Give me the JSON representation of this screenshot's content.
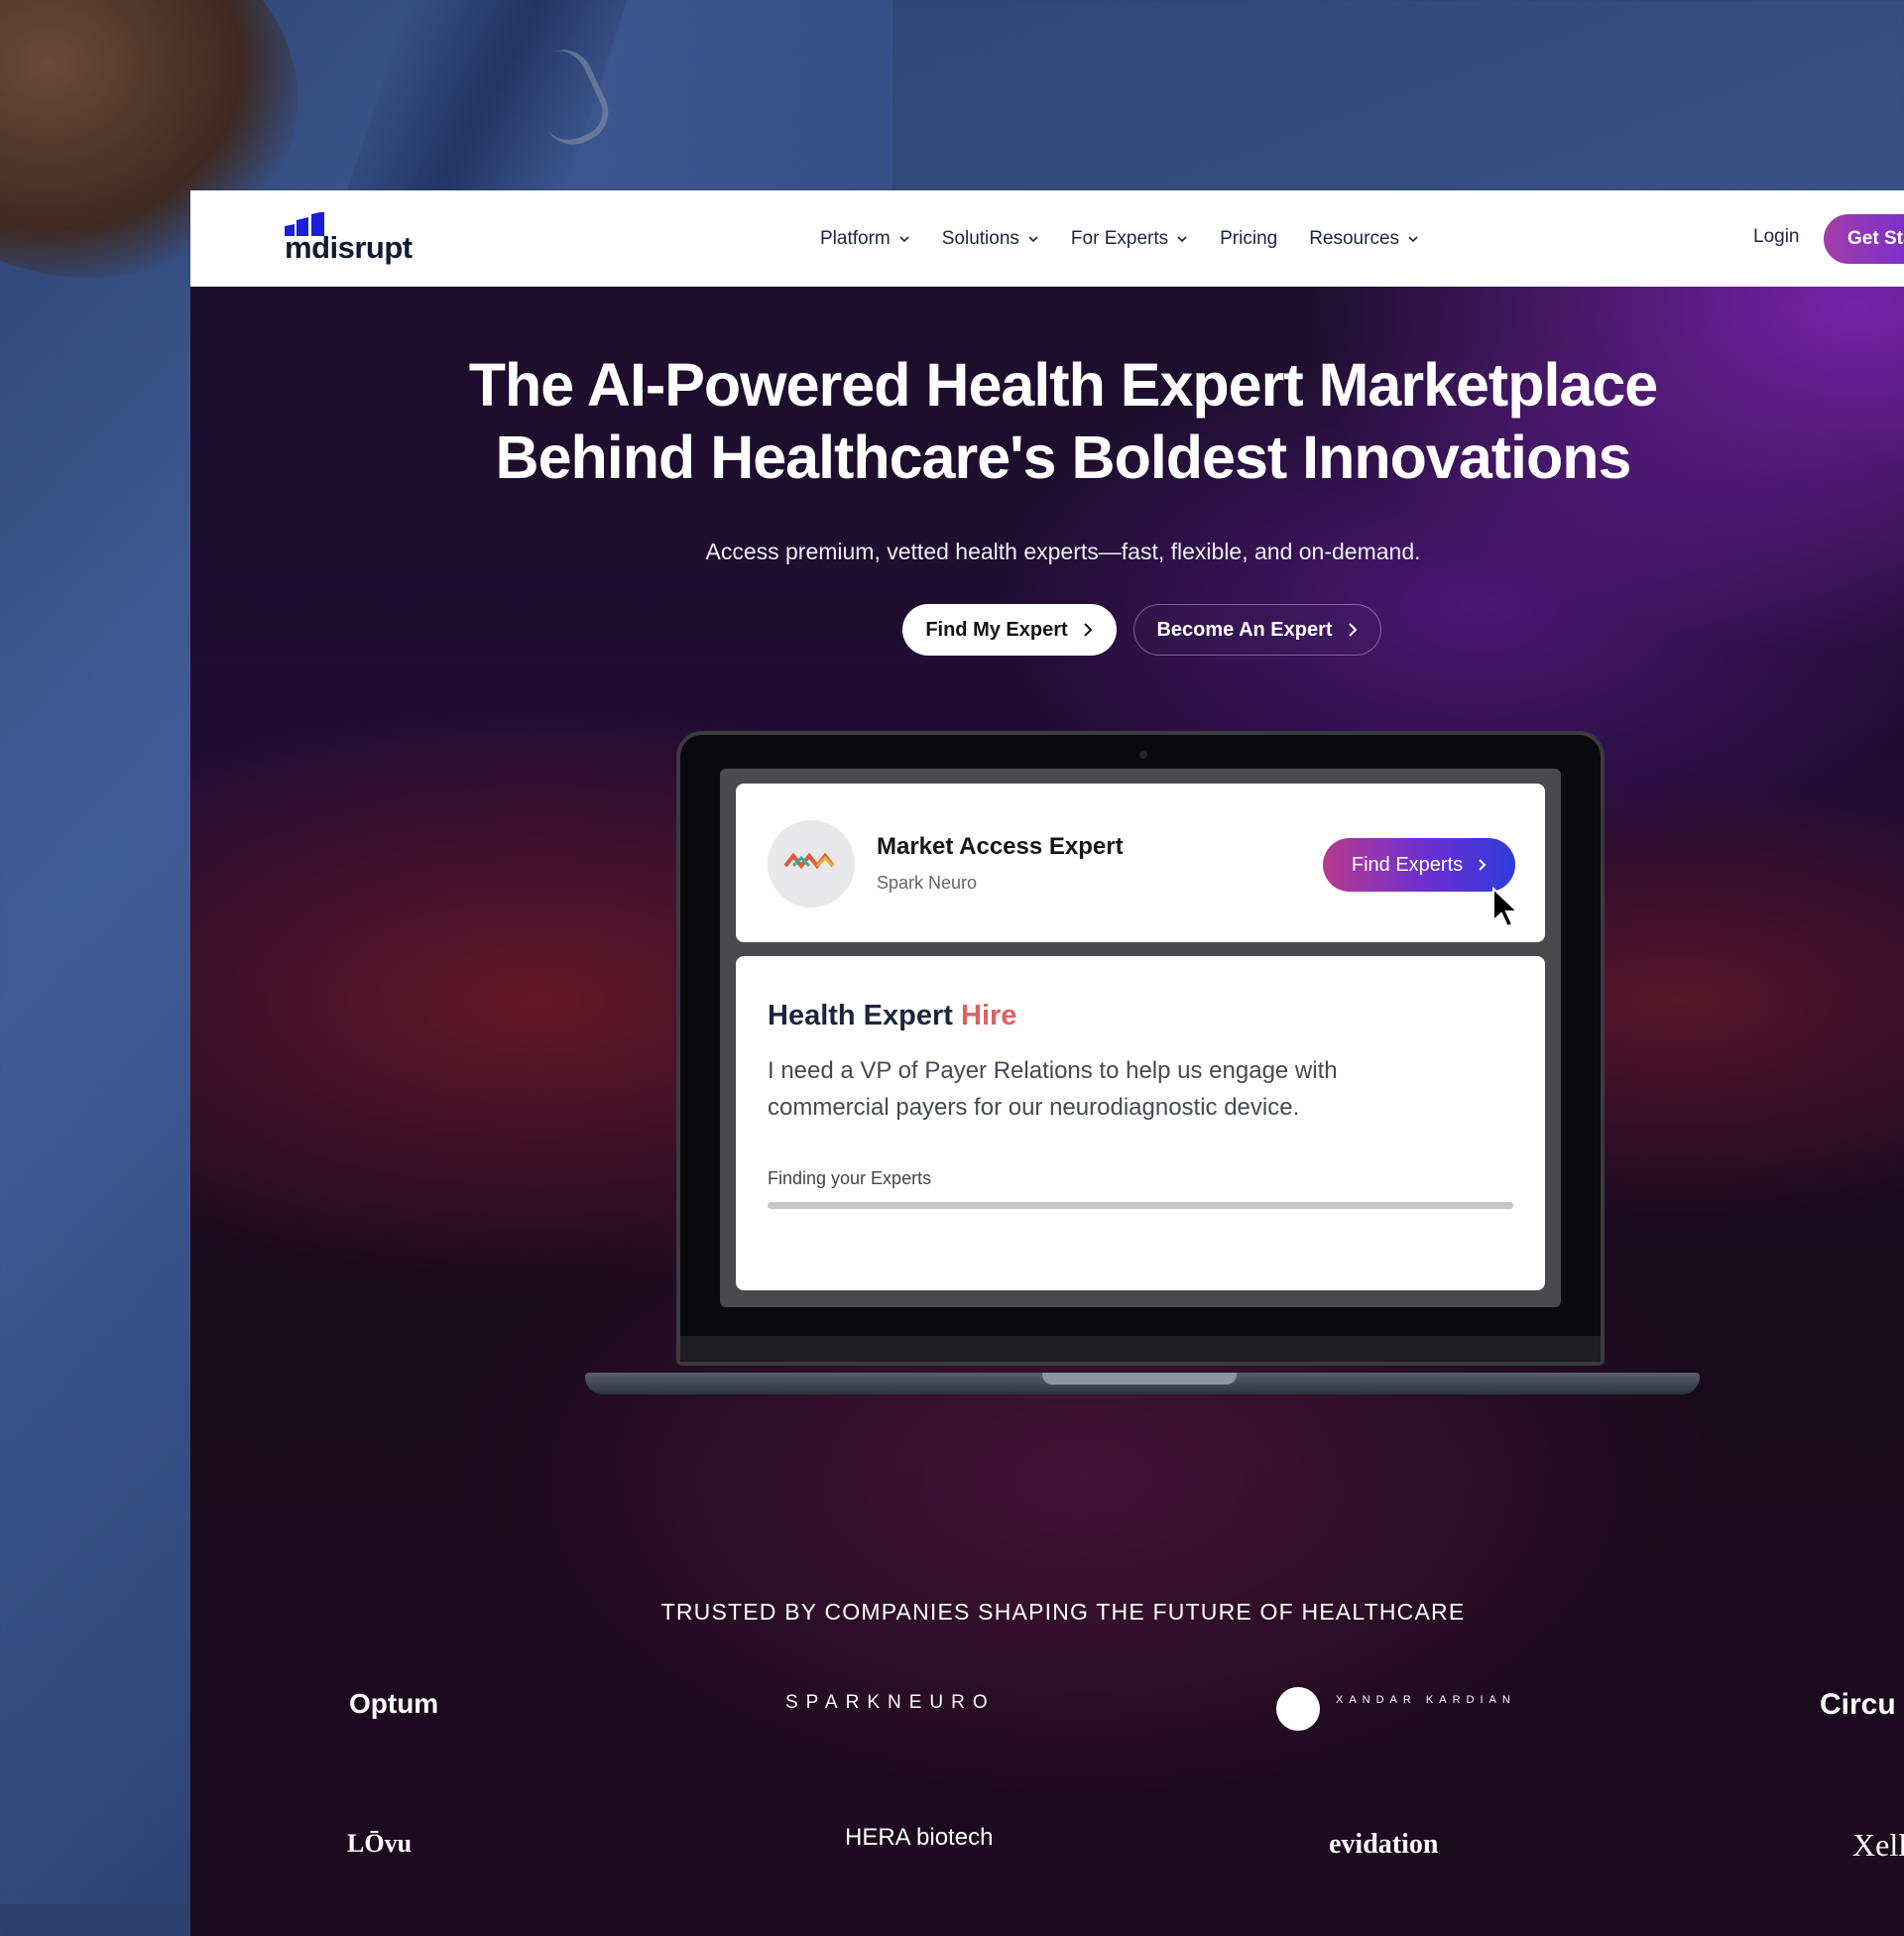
{
  "nav": {
    "logo_text": "mdisrupt",
    "menu": [
      {
        "label": "Platform",
        "has_dropdown": true
      },
      {
        "label": "Solutions",
        "has_dropdown": true
      },
      {
        "label": "For Experts",
        "has_dropdown": true
      },
      {
        "label": "Pricing",
        "has_dropdown": false
      },
      {
        "label": "Resources",
        "has_dropdown": true
      }
    ],
    "login_label": "Login",
    "cta_label": "Get Started"
  },
  "hero": {
    "title_line1": "The AI-Powered Health Expert Marketplace",
    "title_line2": "Behind Healthcare's Boldest Innovations",
    "subtitle": "Access premium, vetted health experts—fast, flexible, and on-demand.",
    "primary_button": "Find My Expert",
    "secondary_button": "Become An Expert"
  },
  "laptop_card": {
    "title": "Market Access Expert",
    "company": "Spark Neuro",
    "avatar_text": "SPARKNEURO",
    "button_label": "Find Experts"
  },
  "hire_card": {
    "title_main": "Health Expert",
    "title_accent": "Hire",
    "description": "I need a VP of Payer Relations to help us engage with commercial payers for our neurodiagnostic device.",
    "status_label": "Finding your Experts",
    "progress": 0
  },
  "trusted": {
    "heading": "TRUSTED BY COMPANIES SHAPING THE FUTURE OF HEALTHCARE",
    "logos": [
      "Optum",
      "SPARKNEURO",
      "XANDAR KARDIAN",
      "Circu",
      "LŌvu",
      "HERA biotech",
      "evidation",
      "Xell"
    ]
  },
  "colors": {
    "brand_blue": "#1a1fd8",
    "cta_gradient_start": "#b83a8f",
    "cta_gradient_end": "#2f3bdc",
    "accent_red": "#e06060"
  }
}
